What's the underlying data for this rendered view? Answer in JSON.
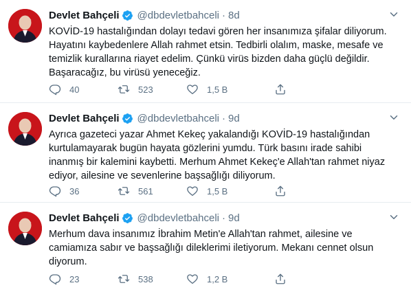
{
  "tweets": [
    {
      "name": "Devlet Bahçeli",
      "handle": "@dbdevletbahceli",
      "separator": "·",
      "time": "8d",
      "lines": [
        "KOVİD-19 hastalığından dolayı tedavi gören her insanımıza şifalar diliyorum.",
        "Hayatını kaybedenlere Allah rahmet etsin. Tedbirli olalım, maske, mesafe ve",
        "temizlik kurallarına riayet edelim. Çünkü virüs bizden daha güçlü değildir.",
        "Başaracağız, bu virüsü yeneceğiz."
      ],
      "replies": "40",
      "retweets": "523",
      "likes": "1,5 B"
    },
    {
      "name": "Devlet Bahçeli",
      "handle": "@dbdevletbahceli",
      "separator": "·",
      "time": "9d",
      "lines": [
        "Ayrıca gazeteci yazar Ahmet Kekeç yakalandığı KOVİD-19 hastalığından",
        "kurtulamayarak bugün hayata gözlerini yumdu. Türk basını irade sahibi",
        "inanmış bir kalemini kaybetti. Merhum Ahmet Kekeç'e Allah'tan rahmet niyaz",
        "ediyor, ailesine ve sevenlerine başsağlığı diliyorum."
      ],
      "replies": "36",
      "retweets": "561",
      "likes": "1,5 B"
    },
    {
      "name": "Devlet Bahçeli",
      "handle": "@dbdevletbahceli",
      "separator": "·",
      "time": "9d",
      "lines": [
        "Merhum dava insanımız İbrahim Metin'e Allah'tan rahmet, ailesine ve",
        "camiamıza sabır ve başsağlığı dileklerimi iletiyorum. Mekanı cennet olsun",
        "diyorum."
      ],
      "replies": "23",
      "retweets": "538",
      "likes": "1,2 B"
    }
  ],
  "icons": {
    "verified": "verified-badge-icon",
    "more": "chevron-down-icon",
    "reply": "reply-icon",
    "retweet": "retweet-icon",
    "like": "heart-icon",
    "share": "share-icon"
  },
  "colors": {
    "text": "#0f1419",
    "muted": "#5b7083",
    "verified": "#1da1f2",
    "divider": "#e6ecf0",
    "avatar_bg": "#c8151b"
  }
}
